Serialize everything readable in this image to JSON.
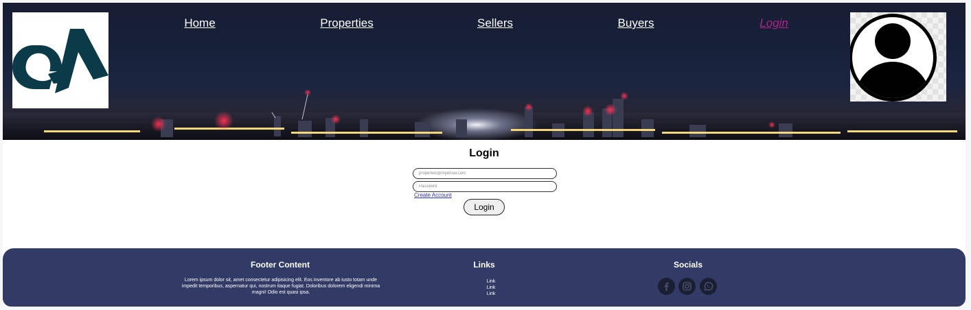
{
  "header": {
    "logo_text": "QA",
    "nav": [
      {
        "label": "Home",
        "active": false
      },
      {
        "label": "Properties",
        "active": false
      },
      {
        "label": "Sellers",
        "active": false
      },
      {
        "label": "Buyers",
        "active": false
      },
      {
        "label": "Login",
        "active": true
      }
    ]
  },
  "login": {
    "title": "Login",
    "email_placeholder": "properties@myemail.com",
    "password_placeholder": "Password",
    "create_account": "Create Account",
    "submit": "Login"
  },
  "footer": {
    "content_heading": "Footer Content",
    "content_text": "Lorem ipsum dolor sit, amet consectetur adipisicing elit. Eos inventore ab iusto totam unde impedit temporibus, aspernatur qui, nostrum itaque fugiat. Doloribus dolorem eligendi minima magni! Odio est quasi ipsa.",
    "links_heading": "Links",
    "links": [
      "Link",
      "Link",
      "Link"
    ],
    "socials_heading": "Socials",
    "socials": [
      "facebook-icon",
      "instagram-icon",
      "whatsapp-icon"
    ]
  },
  "colors": {
    "footer_bg": "#323b66",
    "active_nav": "#b0238a",
    "logo_teal": "#0b3b49"
  }
}
